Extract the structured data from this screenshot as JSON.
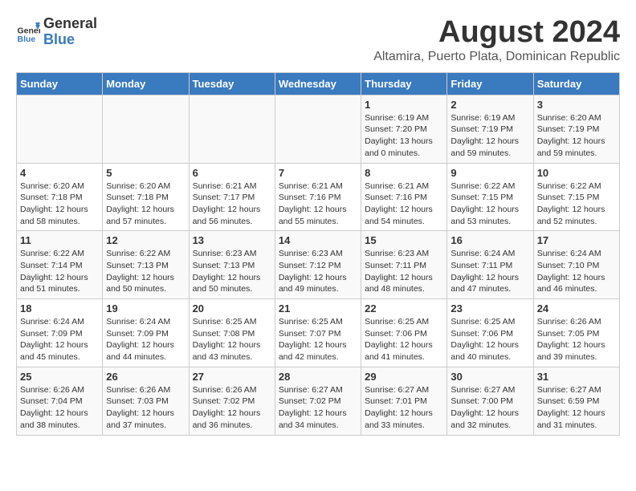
{
  "header": {
    "logo_line1": "General",
    "logo_line2": "Blue",
    "main_title": "August 2024",
    "subtitle": "Altamira, Puerto Plata, Dominican Republic"
  },
  "weekdays": [
    "Sunday",
    "Monday",
    "Tuesday",
    "Wednesday",
    "Thursday",
    "Friday",
    "Saturday"
  ],
  "weeks": [
    [
      {
        "day": "",
        "info": ""
      },
      {
        "day": "",
        "info": ""
      },
      {
        "day": "",
        "info": ""
      },
      {
        "day": "",
        "info": ""
      },
      {
        "day": "1",
        "info": "Sunrise: 6:19 AM\nSunset: 7:20 PM\nDaylight: 13 hours\nand 0 minutes."
      },
      {
        "day": "2",
        "info": "Sunrise: 6:19 AM\nSunset: 7:19 PM\nDaylight: 12 hours\nand 59 minutes."
      },
      {
        "day": "3",
        "info": "Sunrise: 6:20 AM\nSunset: 7:19 PM\nDaylight: 12 hours\nand 59 minutes."
      }
    ],
    [
      {
        "day": "4",
        "info": "Sunrise: 6:20 AM\nSunset: 7:18 PM\nDaylight: 12 hours\nand 58 minutes."
      },
      {
        "day": "5",
        "info": "Sunrise: 6:20 AM\nSunset: 7:18 PM\nDaylight: 12 hours\nand 57 minutes."
      },
      {
        "day": "6",
        "info": "Sunrise: 6:21 AM\nSunset: 7:17 PM\nDaylight: 12 hours\nand 56 minutes."
      },
      {
        "day": "7",
        "info": "Sunrise: 6:21 AM\nSunset: 7:16 PM\nDaylight: 12 hours\nand 55 minutes."
      },
      {
        "day": "8",
        "info": "Sunrise: 6:21 AM\nSunset: 7:16 PM\nDaylight: 12 hours\nand 54 minutes."
      },
      {
        "day": "9",
        "info": "Sunrise: 6:22 AM\nSunset: 7:15 PM\nDaylight: 12 hours\nand 53 minutes."
      },
      {
        "day": "10",
        "info": "Sunrise: 6:22 AM\nSunset: 7:15 PM\nDaylight: 12 hours\nand 52 minutes."
      }
    ],
    [
      {
        "day": "11",
        "info": "Sunrise: 6:22 AM\nSunset: 7:14 PM\nDaylight: 12 hours\nand 51 minutes."
      },
      {
        "day": "12",
        "info": "Sunrise: 6:22 AM\nSunset: 7:13 PM\nDaylight: 12 hours\nand 50 minutes."
      },
      {
        "day": "13",
        "info": "Sunrise: 6:23 AM\nSunset: 7:13 PM\nDaylight: 12 hours\nand 50 minutes."
      },
      {
        "day": "14",
        "info": "Sunrise: 6:23 AM\nSunset: 7:12 PM\nDaylight: 12 hours\nand 49 minutes."
      },
      {
        "day": "15",
        "info": "Sunrise: 6:23 AM\nSunset: 7:11 PM\nDaylight: 12 hours\nand 48 minutes."
      },
      {
        "day": "16",
        "info": "Sunrise: 6:24 AM\nSunset: 7:11 PM\nDaylight: 12 hours\nand 47 minutes."
      },
      {
        "day": "17",
        "info": "Sunrise: 6:24 AM\nSunset: 7:10 PM\nDaylight: 12 hours\nand 46 minutes."
      }
    ],
    [
      {
        "day": "18",
        "info": "Sunrise: 6:24 AM\nSunset: 7:09 PM\nDaylight: 12 hours\nand 45 minutes."
      },
      {
        "day": "19",
        "info": "Sunrise: 6:24 AM\nSunset: 7:09 PM\nDaylight: 12 hours\nand 44 minutes."
      },
      {
        "day": "20",
        "info": "Sunrise: 6:25 AM\nSunset: 7:08 PM\nDaylight: 12 hours\nand 43 minutes."
      },
      {
        "day": "21",
        "info": "Sunrise: 6:25 AM\nSunset: 7:07 PM\nDaylight: 12 hours\nand 42 minutes."
      },
      {
        "day": "22",
        "info": "Sunrise: 6:25 AM\nSunset: 7:06 PM\nDaylight: 12 hours\nand 41 minutes."
      },
      {
        "day": "23",
        "info": "Sunrise: 6:25 AM\nSunset: 7:06 PM\nDaylight: 12 hours\nand 40 minutes."
      },
      {
        "day": "24",
        "info": "Sunrise: 6:26 AM\nSunset: 7:05 PM\nDaylight: 12 hours\nand 39 minutes."
      }
    ],
    [
      {
        "day": "25",
        "info": "Sunrise: 6:26 AM\nSunset: 7:04 PM\nDaylight: 12 hours\nand 38 minutes."
      },
      {
        "day": "26",
        "info": "Sunrise: 6:26 AM\nSunset: 7:03 PM\nDaylight: 12 hours\nand 37 minutes."
      },
      {
        "day": "27",
        "info": "Sunrise: 6:26 AM\nSunset: 7:02 PM\nDaylight: 12 hours\nand 36 minutes."
      },
      {
        "day": "28",
        "info": "Sunrise: 6:27 AM\nSunset: 7:02 PM\nDaylight: 12 hours\nand 34 minutes."
      },
      {
        "day": "29",
        "info": "Sunrise: 6:27 AM\nSunset: 7:01 PM\nDaylight: 12 hours\nand 33 minutes."
      },
      {
        "day": "30",
        "info": "Sunrise: 6:27 AM\nSunset: 7:00 PM\nDaylight: 12 hours\nand 32 minutes."
      },
      {
        "day": "31",
        "info": "Sunrise: 6:27 AM\nSunset: 6:59 PM\nDaylight: 12 hours\nand 31 minutes."
      }
    ]
  ]
}
